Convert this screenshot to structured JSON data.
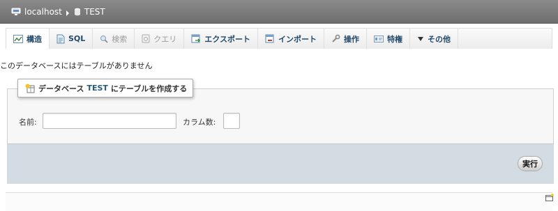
{
  "breadcrumb": {
    "server": "localhost",
    "database": "TEST"
  },
  "tabs": [
    {
      "label": "構造",
      "icon": "structure-icon",
      "state": "active"
    },
    {
      "label": "SQL",
      "icon": "sql-icon",
      "state": "normal"
    },
    {
      "label": "検索",
      "icon": "search-icon",
      "state": "disabled"
    },
    {
      "label": "クエリ",
      "icon": "query-icon",
      "state": "disabled"
    },
    {
      "label": "エクスポート",
      "icon": "export-icon",
      "state": "normal"
    },
    {
      "label": "インポート",
      "icon": "import-icon",
      "state": "normal"
    },
    {
      "label": "操作",
      "icon": "wrench-icon",
      "state": "normal"
    },
    {
      "label": "特権",
      "icon": "privileges-icon",
      "state": "normal"
    },
    {
      "label": "その他",
      "icon": "triangle-down-icon",
      "state": "normal"
    }
  ],
  "message": "このデータベースにはテーブルがありません",
  "create_form": {
    "legend_before": "データベース",
    "legend_table": "TEST",
    "legend_after": "にテーブルを作成する",
    "name_label": "名前:",
    "name_value": "",
    "columns_label": "カラム数:",
    "columns_value": "",
    "go_label": "実行"
  },
  "colors": {
    "topbar": "#7b7b7b",
    "tab_text": "#234a6b",
    "footer_bg": "#d3dce3"
  }
}
